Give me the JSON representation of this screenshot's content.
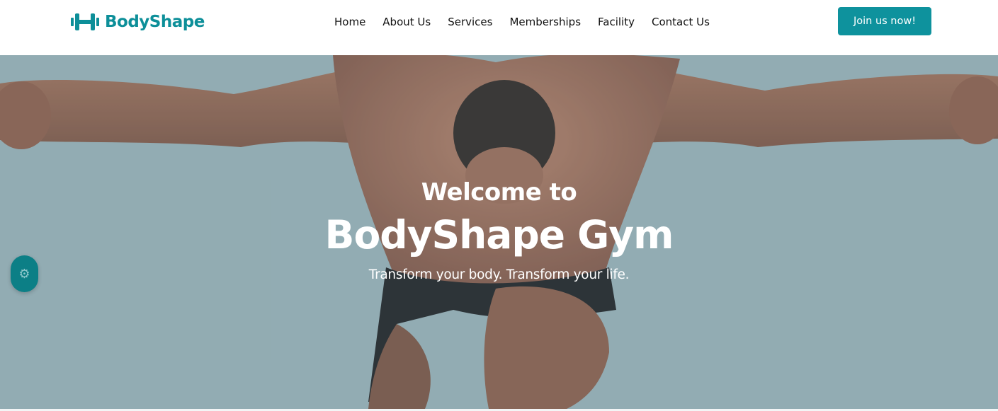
{
  "brand": {
    "name": "BodyShape",
    "icon": "dumbbell-icon",
    "color": "#0d8f99"
  },
  "nav": {
    "items": [
      {
        "label": "Home"
      },
      {
        "label": "About Us"
      },
      {
        "label": "Services"
      },
      {
        "label": "Memberships"
      },
      {
        "label": "Facility"
      },
      {
        "label": "Contact Us"
      }
    ],
    "cta_label": "Join us now!"
  },
  "hero": {
    "welcome": "Welcome to",
    "title": "BodyShape Gym",
    "tagline": "Transform your body. Transform your life.",
    "background_color": "#98b1b7"
  },
  "settings": {
    "icon": "gear-icon",
    "color": "#0c7f86"
  }
}
